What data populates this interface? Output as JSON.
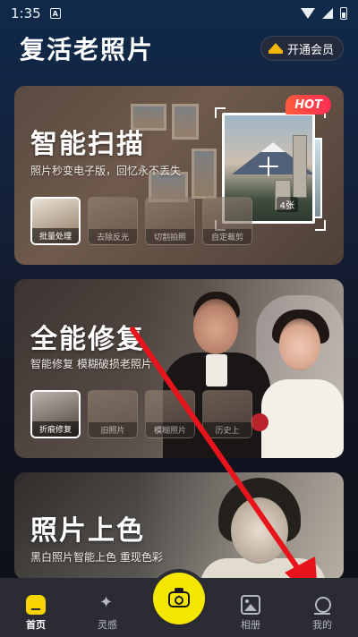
{
  "status_bar": {
    "time": "1:35",
    "notification_letter": "A"
  },
  "header": {
    "title": "复活老照片",
    "vip_label": "开通会员"
  },
  "cards": {
    "scan": {
      "title": "智能扫描",
      "subtitle": "照片秒变电子版，回忆永不丢失",
      "badge": "HOT",
      "photo_count": "4张",
      "thumbnails": [
        "批量处理",
        "去除反光",
        "切割拍照",
        "自定裁剪"
      ]
    },
    "repair": {
      "title": "全能修复",
      "subtitle": "智能修复 模糊破损老照片",
      "thumbnails": [
        "折痕修复",
        "旧照片",
        "模糊照片",
        "历史上"
      ]
    },
    "colorize": {
      "title": "照片上色",
      "subtitle": "黑白照片智能上色 重现色彩"
    }
  },
  "bottom_nav": {
    "home": "首页",
    "inspiration": "灵感",
    "album": "相册",
    "mine": "我的"
  },
  "colors": {
    "accent_yellow": "#f5e600",
    "hot_red": "#ff2d55",
    "arrow_red": "#e8141c"
  }
}
